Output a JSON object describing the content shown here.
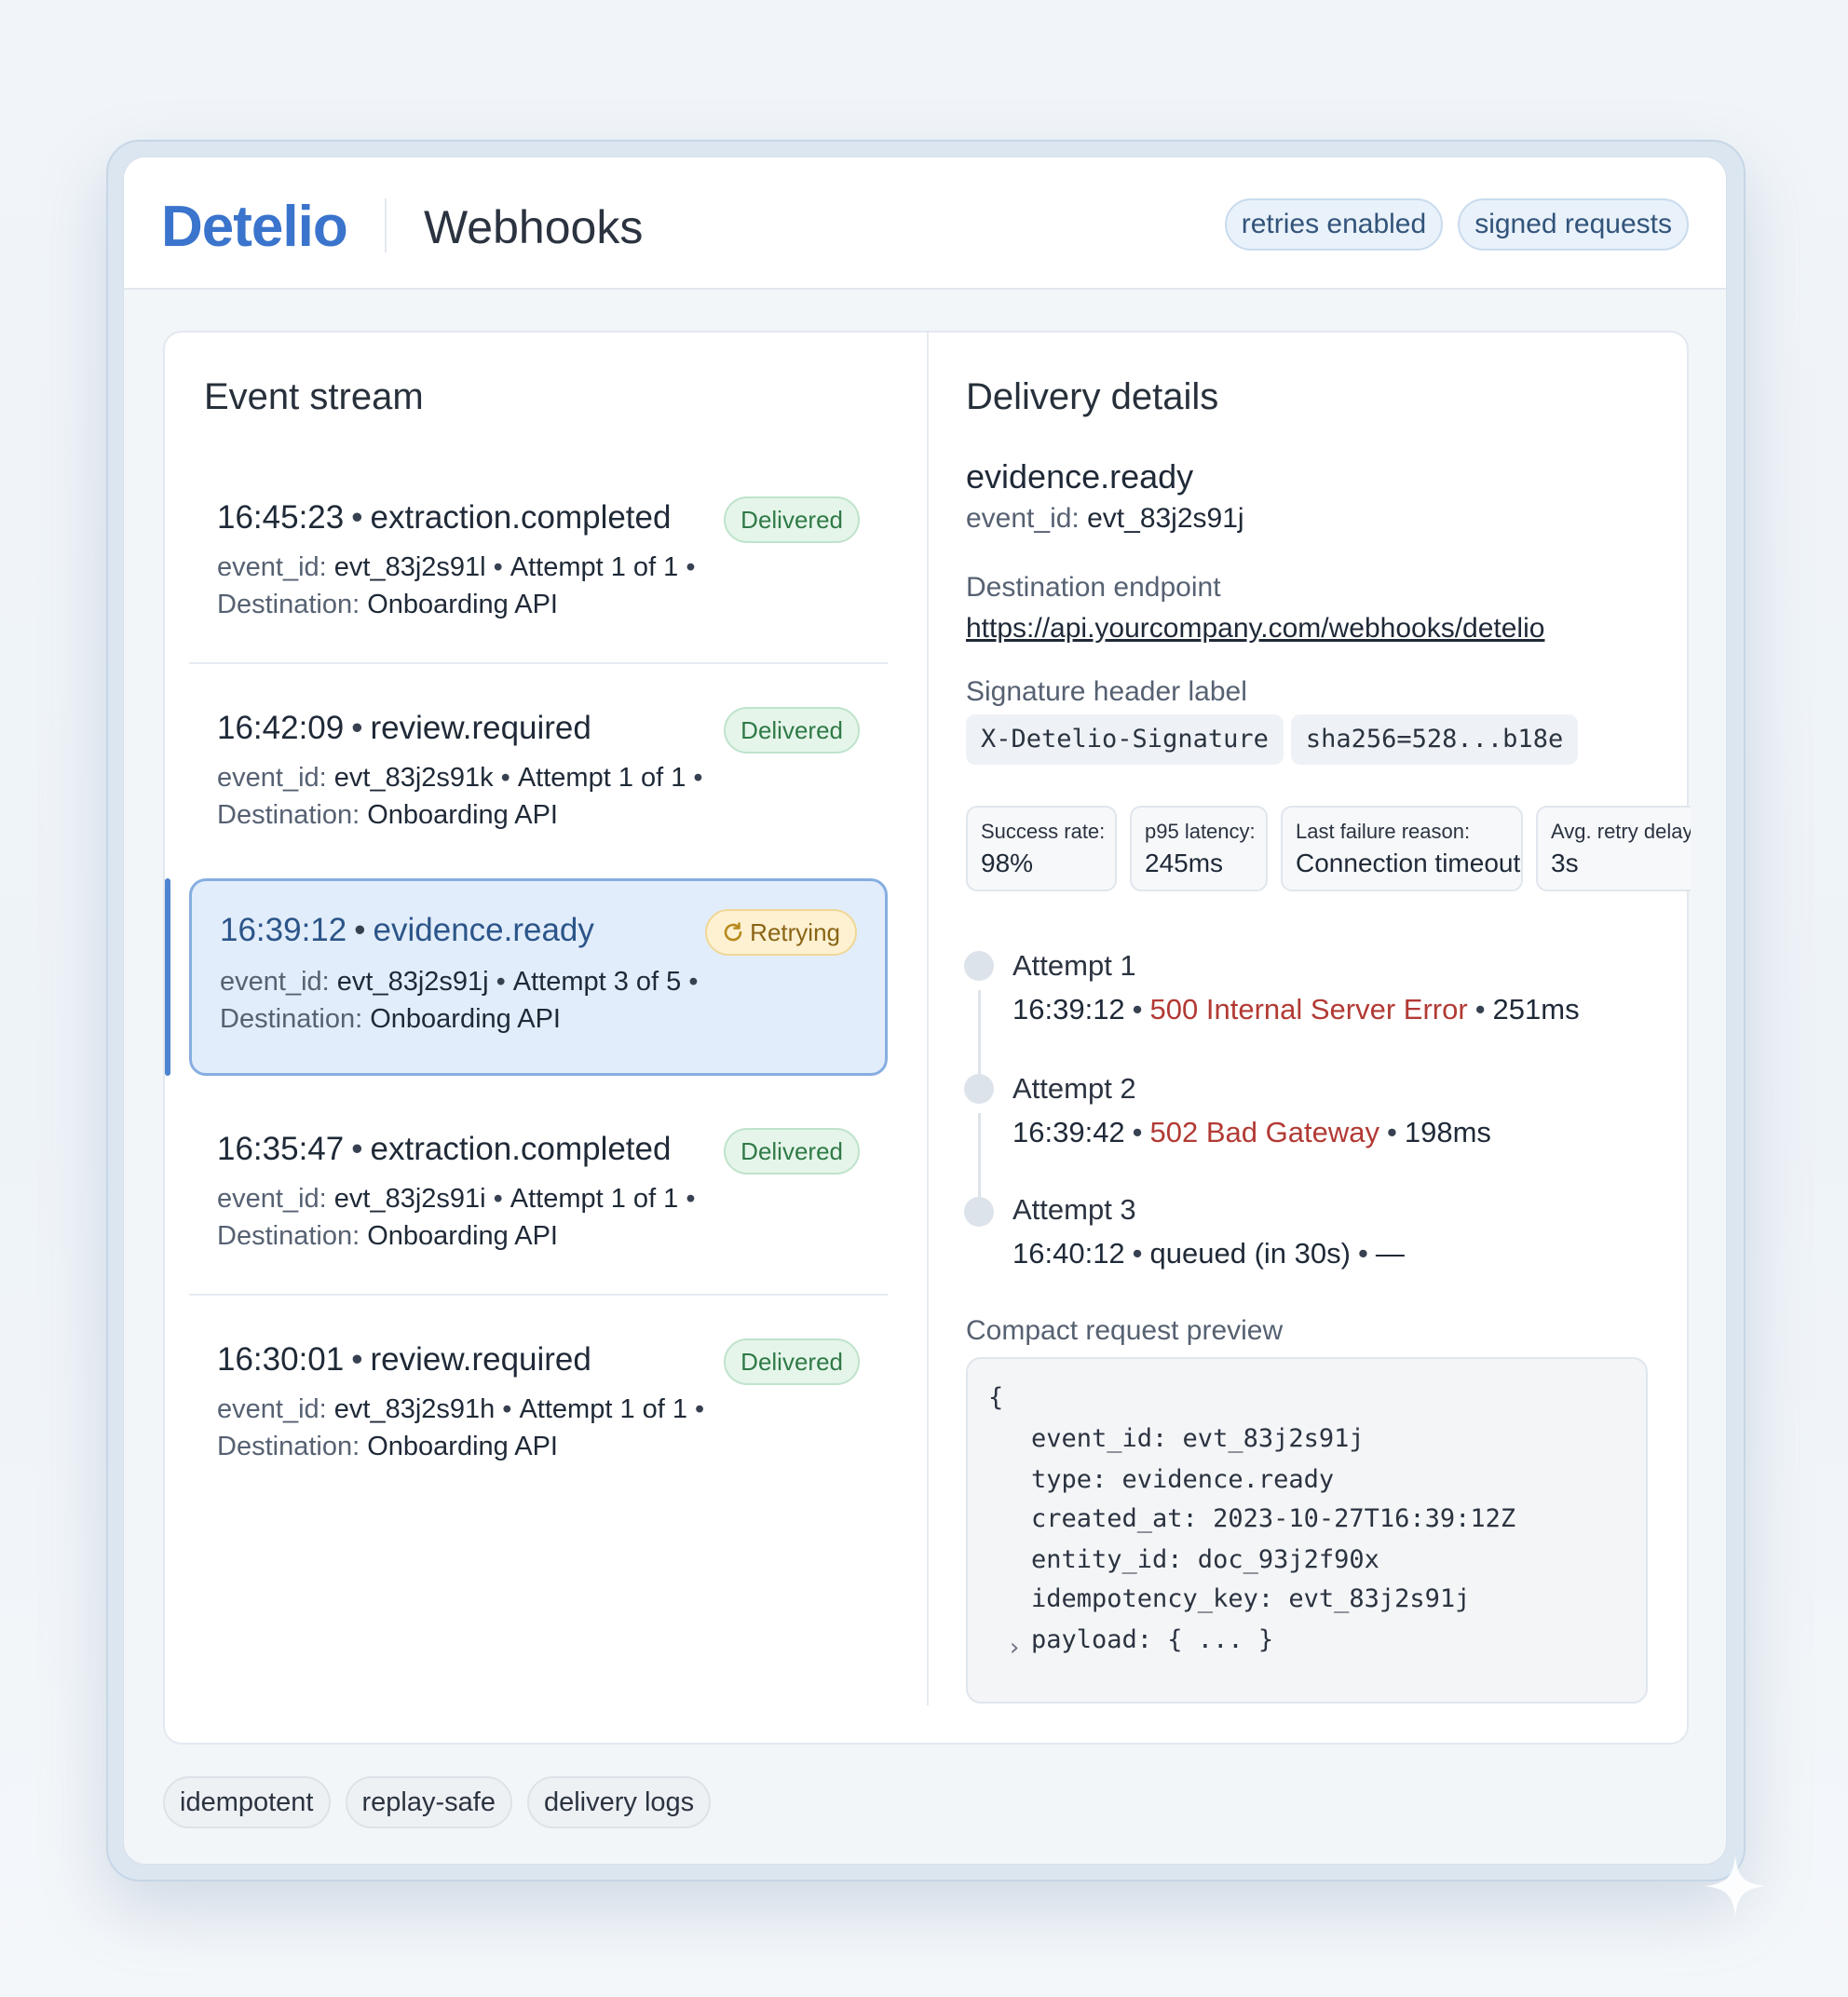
{
  "header": {
    "logo": "Detelio",
    "title": "Webhooks",
    "chips": [
      "retries enabled",
      "signed requests"
    ]
  },
  "event_stream": {
    "title": "Event stream",
    "events": [
      {
        "time": "16:45:23",
        "type": "extraction.completed",
        "status": "Delivered",
        "event_id_label": "event_id:",
        "event_id": "evt_83j2s91l",
        "attempt": "Attempt 1 of 1",
        "destination_label": "Destination:",
        "destination": "Onboarding API"
      },
      {
        "time": "16:42:09",
        "type": "review.required",
        "status": "Delivered",
        "event_id_label": "event_id:",
        "event_id": "evt_83j2s91k",
        "attempt": "Attempt 1 of 1",
        "destination_label": "Destination:",
        "destination": "Onboarding API"
      },
      {
        "time": "16:39:12",
        "type": "evidence.ready",
        "status": "Retrying",
        "event_id_label": "event_id:",
        "event_id": "evt_83j2s91j",
        "attempt": "Attempt 3 of 5",
        "destination_label": "Destination:",
        "destination": "Onboarding API"
      },
      {
        "time": "16:35:47",
        "type": "extraction.completed",
        "status": "Delivered",
        "event_id_label": "event_id:",
        "event_id": "evt_83j2s91i",
        "attempt": "Attempt 1 of 1",
        "destination_label": "Destination:",
        "destination": "Onboarding API"
      },
      {
        "time": "16:30:01",
        "type": "review.required",
        "status": "Delivered",
        "event_id_label": "event_id:",
        "event_id": "evt_83j2s91h",
        "attempt": "Attempt 1 of 1",
        "destination_label": "Destination:",
        "destination": "Onboarding API"
      }
    ]
  },
  "details": {
    "title": "Delivery details",
    "event_name": "evidence.ready",
    "event_id_label": "event_id:",
    "event_id": "evt_83j2s91j",
    "endpoint_label": "Destination endpoint",
    "endpoint_url": "https://api.yourcompany.com/webhooks/detelio",
    "signature_label": "Signature header label",
    "signature_header": "X-Detelio-Signature",
    "signature_value": "sha256=528...b18e",
    "metrics": [
      {
        "label": "Success rate:",
        "value": "98%"
      },
      {
        "label": "p95 latency:",
        "value": "245ms"
      },
      {
        "label": "Last failure reason:",
        "value": "Connection timeout"
      },
      {
        "label": "Avg. retry delay",
        "value": "3s"
      }
    ],
    "attempts": [
      {
        "title": "Attempt 1",
        "time": "16:39:12",
        "result": "500 Internal Server Error",
        "duration": "251ms",
        "is_error": true
      },
      {
        "title": "Attempt 2",
        "time": "16:39:42",
        "result": "502 Bad Gateway",
        "duration": "198ms",
        "is_error": true
      },
      {
        "title": "Attempt 3",
        "time": "16:40:12",
        "result": "queued (in 30s)",
        "duration": "—",
        "is_error": false
      }
    ],
    "preview_label": "Compact request preview",
    "preview_lines": [
      "{",
      "event_id: evt_83j2s91j",
      "type: evidence.ready",
      "created_at: 2023-10-27T16:39:12Z",
      "entity_id: doc_93j2f90x",
      "idempotency_key: evt_83j2s91j",
      "payload: { ... }"
    ]
  },
  "footer": {
    "chips": [
      "idempotent",
      "replay-safe",
      "delivery logs"
    ]
  },
  "colors": {
    "brand": "#3a74cc",
    "error": "#b23a34",
    "delivered": "#2f7a46",
    "retrying": "#8a6415",
    "selected_bg": "#e2edfb"
  }
}
